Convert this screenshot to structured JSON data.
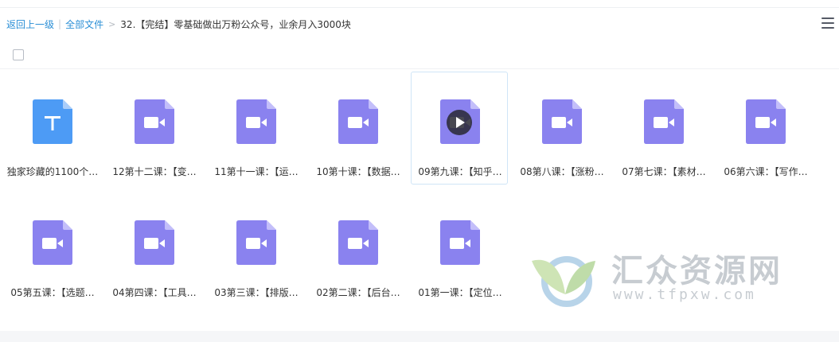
{
  "breadcrumb": {
    "back": "返回上一级",
    "all_files": "全部文件",
    "arrow": ">",
    "current": "32.【完结】零基础做出万粉公众号，业余月入3000块"
  },
  "colors": {
    "link": "#2b8fd6",
    "video_icon": "#8a82ef",
    "doc_icon": "#4d9bf5"
  },
  "files": [
    {
      "name": "独家珍藏的1100个…",
      "type": "text",
      "icon": "text-file-icon"
    },
    {
      "name": "12第十二课：【变…",
      "type": "video",
      "icon": "video-file-icon"
    },
    {
      "name": "11第十一课：【运…",
      "type": "video",
      "icon": "video-file-icon"
    },
    {
      "name": "10第十课：【数据…",
      "type": "video",
      "icon": "video-file-icon"
    },
    {
      "name": "09第九课：【知乎…",
      "type": "video",
      "icon": "video-file-icon",
      "hovered": true
    },
    {
      "name": "08第八课：【涨粉…",
      "type": "video",
      "icon": "video-file-icon"
    },
    {
      "name": "07第七课：【素材…",
      "type": "video",
      "icon": "video-file-icon"
    },
    {
      "name": "06第六课：【写作…",
      "type": "video",
      "icon": "video-file-icon"
    },
    {
      "name": "05第五课：【选题…",
      "type": "video",
      "icon": "video-file-icon"
    },
    {
      "name": "04第四课：【工具…",
      "type": "video",
      "icon": "video-file-icon"
    },
    {
      "name": "03第三课：【排版…",
      "type": "video",
      "icon": "video-file-icon"
    },
    {
      "name": "02第二课：【后台…",
      "type": "video",
      "icon": "video-file-icon"
    },
    {
      "name": "01第一课：【定位…",
      "type": "video",
      "icon": "video-file-icon"
    }
  ],
  "watermark": {
    "title": "汇众资源网",
    "url": "www.tfpxw.com"
  }
}
